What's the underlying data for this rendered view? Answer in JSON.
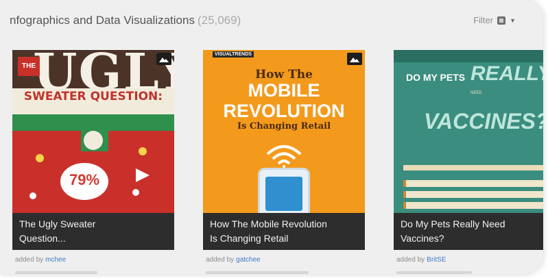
{
  "header": {
    "title": "nfographics and Data Visualizations",
    "count": "(25,069)",
    "filter_label": "Filter"
  },
  "cards": [
    {
      "caption_line1": "The Ugly Sweater",
      "caption_line2": "Question...",
      "byline_prefix": "added by",
      "byline_user": "mchee",
      "art": {
        "the": "THE",
        "big": "UGLY",
        "sub": "SWEATER QUESTION:",
        "pct": "79%"
      }
    },
    {
      "caption_line1": "How The Mobile Revolution",
      "caption_line2": "Is Changing Retail",
      "byline_prefix": "added by",
      "byline_user": "gatchee",
      "art": {
        "brand": "VISUALTRENDS",
        "t1": "How The",
        "t2a": "MOBILE",
        "t2b": "REVOLUTION",
        "t3": "Is Changing Retail"
      }
    },
    {
      "caption_line1": "Do My Pets Really Need",
      "caption_line2": "Vaccines?",
      "byline_prefix": "added by",
      "byline_user": "BritSE",
      "art": {
        "q1": "DO MY PETS",
        "q2": "REALLY",
        "q3": "NEED",
        "q4": "VACCINES?"
      }
    }
  ],
  "colors": {
    "panel_bg": "#efefef",
    "caption_bg": "#2d2d2d",
    "link": "#3b7ac9"
  },
  "icons": [
    "filter-grid-icon",
    "chevron-down-icon",
    "mountain-badge-icon"
  ]
}
